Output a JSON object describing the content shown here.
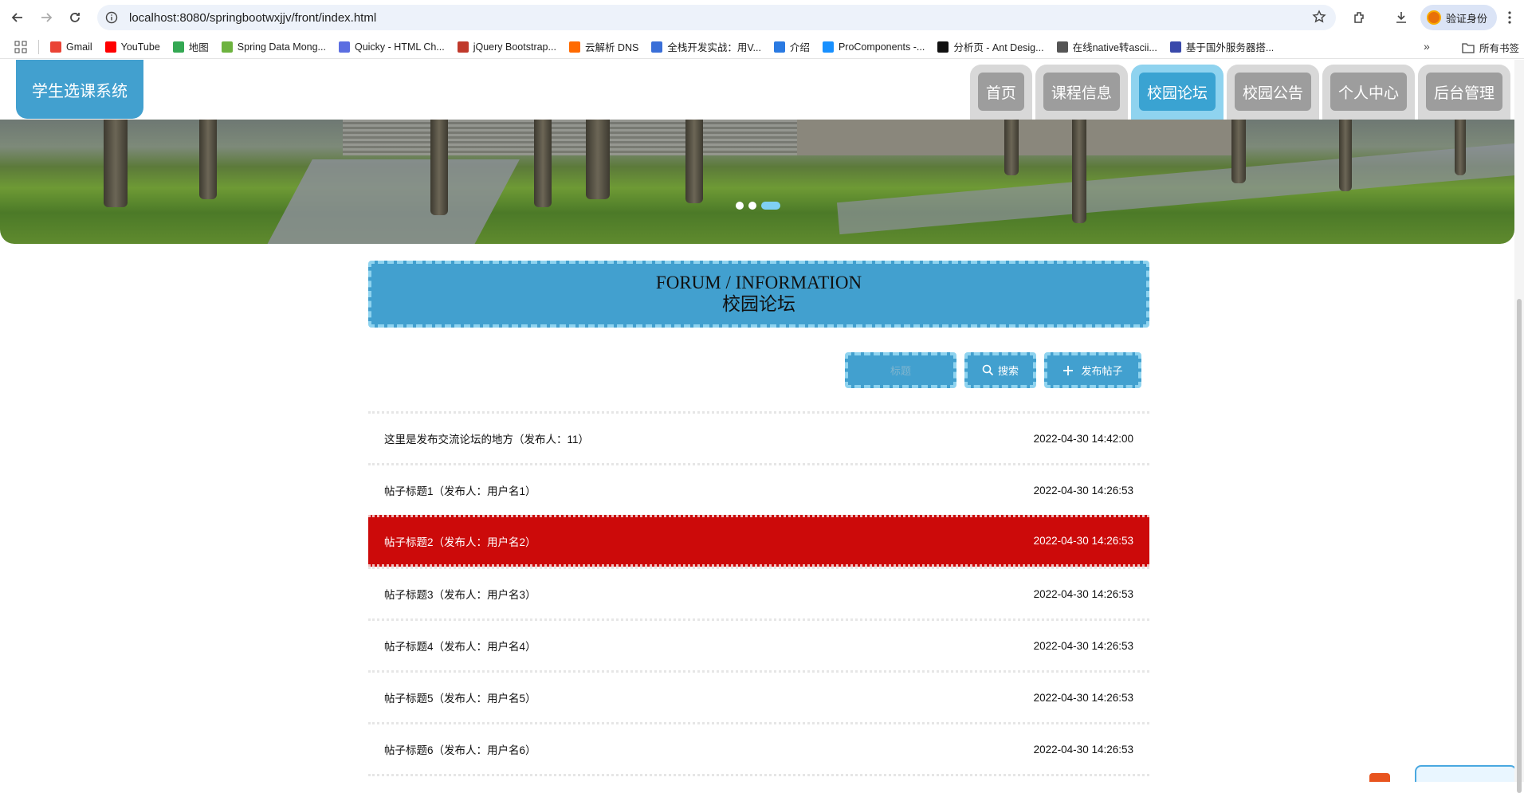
{
  "browser": {
    "url": "localhost:8080/springbootwxjjv/front/index.html",
    "profile_label": "验证身份",
    "bookmarks": [
      {
        "label": "Gmail",
        "color": "#ea4335"
      },
      {
        "label": "YouTube",
        "color": "#ff0000"
      },
      {
        "label": "地图",
        "color": "#34a853"
      },
      {
        "label": "Spring Data Mong...",
        "color": "#6db33f"
      },
      {
        "label": "Quicky - HTML Ch...",
        "color": "#5b6ee1"
      },
      {
        "label": "jQuery Bootstrap...",
        "color": "#c0392b"
      },
      {
        "label": "云解析 DNS",
        "color": "#ff6a00"
      },
      {
        "label": "全栈开发实战：用V...",
        "color": "#3a6fd8"
      },
      {
        "label": "介绍",
        "color": "#2a7ae2"
      },
      {
        "label": "ProComponents -...",
        "color": "#1890ff"
      },
      {
        "label": "分析页 - Ant Desig...",
        "color": "#111111"
      },
      {
        "label": "在线native转ascii...",
        "color": "#555555"
      },
      {
        "label": "基于国外服务器搭...",
        "color": "#3949ab"
      }
    ],
    "all_bookmarks_label": "所有书签"
  },
  "site": {
    "logo": "学生选课系统",
    "nav": [
      {
        "label": "首页",
        "active": false
      },
      {
        "label": "课程信息",
        "active": false
      },
      {
        "label": "校园论坛",
        "active": true
      },
      {
        "label": "校园公告",
        "active": false
      },
      {
        "label": "个人中心",
        "active": false
      },
      {
        "label": "后台管理",
        "active": false
      }
    ]
  },
  "banner": {
    "slide_count": 3,
    "current_slide": 3
  },
  "section": {
    "title_en": "FORUM / INFORMATION",
    "title_cn": "校园论坛"
  },
  "toolbar": {
    "search_placeholder": "标题",
    "search_label": "搜索",
    "post_label": "发布帖子"
  },
  "posts": [
    {
      "title": "这里是发布交流论坛的地方（发布人：11）",
      "time": "2022-04-30 14:42:00",
      "highlight": false
    },
    {
      "title": "帖子标题1（发布人：用户名1）",
      "time": "2022-04-30 14:26:53",
      "highlight": false
    },
    {
      "title": "帖子标题2（发布人：用户名2）",
      "time": "2022-04-30 14:26:53",
      "highlight": true
    },
    {
      "title": "帖子标题3（发布人：用户名3）",
      "time": "2022-04-30 14:26:53",
      "highlight": false
    },
    {
      "title": "帖子标题4（发布人：用户名4）",
      "time": "2022-04-30 14:26:53",
      "highlight": false
    },
    {
      "title": "帖子标题5（发布人：用户名5）",
      "time": "2022-04-30 14:26:53",
      "highlight": false
    },
    {
      "title": "帖子标题6（发布人：用户名6）",
      "time": "2022-04-30 14:26:53",
      "highlight": false
    }
  ],
  "colors": {
    "primary": "#42a0cf",
    "primary_light": "#8fd3ef",
    "highlight_row": "#cc0a0a",
    "nav_inactive": "#9d9d9d"
  }
}
